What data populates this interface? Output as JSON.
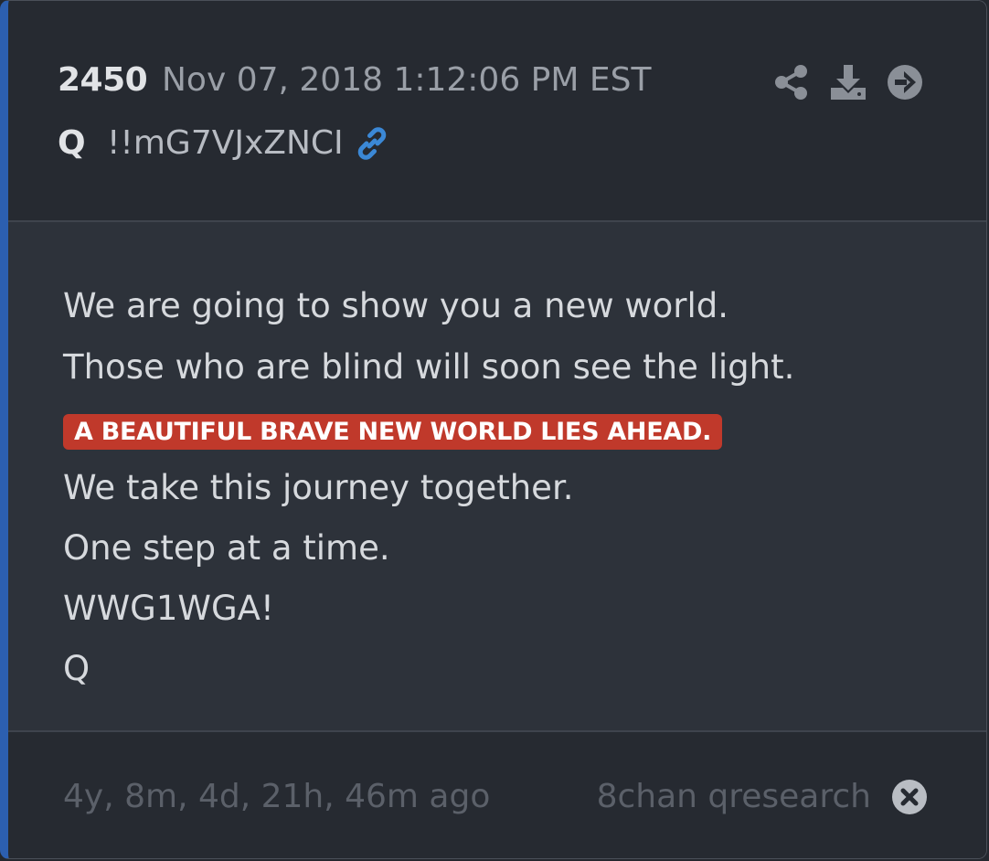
{
  "post": {
    "number": "2450",
    "timestamp": "Nov 07, 2018 1:12:06 PM EST",
    "author": "Q",
    "tripcode": "!!mG7VJxZNCI"
  },
  "header_actions": [
    {
      "icon": "share-icon"
    },
    {
      "icon": "download-icon"
    },
    {
      "icon": "arrow-right-circle-icon"
    }
  ],
  "message": {
    "line1": "We are going to show you a new world.",
    "line2": "Those who are blind will soon see the light.",
    "highlight": "A BEAUTIFUL BRAVE NEW WORLD LIES AHEAD.",
    "line3": "We take this journey together.",
    "line4": "One step at a time.",
    "line5": "WWG1WGA!",
    "line6": "Q"
  },
  "footer": {
    "ago": "4y, 8m, 4d, 21h, 46m ago",
    "source": "8chan qresearch"
  },
  "colors": {
    "accent_bar": "#2c5fb0",
    "link": "#3b88d6",
    "highlight_bg": "#c0392b"
  }
}
